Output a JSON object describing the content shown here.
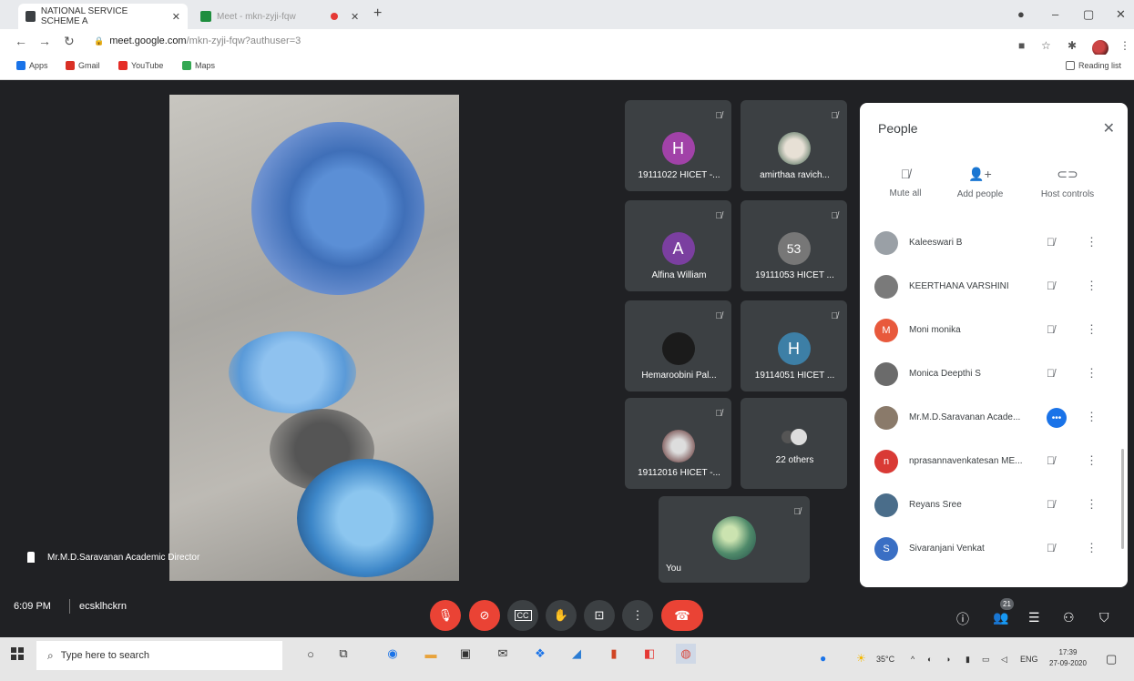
{
  "browser": {
    "tabs": [
      {
        "title": "NATIONAL SERVICE SCHEME A",
        "active": true
      },
      {
        "title": "Meet - mkn-zyji-fqw",
        "active": false
      },
      {
        "title": "",
        "active": false
      }
    ],
    "address": {
      "host": "meet.google.com",
      "path": "/mkn-zyji-fqw?authuser=3"
    },
    "bookmarks": [
      "Apps",
      "Gmail",
      "YouTube",
      "Maps"
    ],
    "reading_list": "Reading list"
  },
  "meet": {
    "main_speaker": "Mr.M.D.Saravanan Academic Director",
    "time": "6:09 PM",
    "meeting_code": "ecsklhckrn",
    "participant_count": "21",
    "tiles": [
      {
        "initial": "H",
        "name": "19111022 HICET -...",
        "color": "#a142a8"
      },
      {
        "initial": "",
        "name": "amirthaa ravich...",
        "color": "#8a9a8a"
      },
      {
        "initial": "A",
        "name": "Alfina William",
        "color": "#7b3fa0"
      },
      {
        "initial": "53",
        "name": "19111053 HICET ...",
        "color": "#777777"
      },
      {
        "initial": "",
        "name": "Hemaroobini Pal...",
        "color": "#222222"
      },
      {
        "initial": "H",
        "name": "19114051 HICET ...",
        "color": "#3d7fa6"
      },
      {
        "initial": "",
        "name": "19112016 HICET -...",
        "color": "#8c6d6d"
      },
      {
        "initial": "",
        "name": "22 others",
        "color": "#3c4043"
      },
      {
        "initial": "",
        "name": "You",
        "color": "#4f8a6a"
      }
    ]
  },
  "people": {
    "title": "People",
    "actions": [
      {
        "label": "Mute all",
        "icon": "mic-off-icon"
      },
      {
        "label": "Add people",
        "icon": "add-person-icon"
      },
      {
        "label": "Host controls",
        "icon": "toggle-icon"
      }
    ],
    "list": [
      {
        "name": "Kaleeswari B",
        "initial": "",
        "color": "#9aa0a6",
        "state": "muted"
      },
      {
        "name": "KEERTHANA VARSHINI",
        "initial": "",
        "color": "#7a7a7a",
        "state": "muted"
      },
      {
        "name": "Moni monika",
        "initial": "M",
        "color": "#e8593c",
        "state": "muted"
      },
      {
        "name": "Monica Deepthi S",
        "initial": "",
        "color": "#6b6b6b",
        "state": "muted"
      },
      {
        "name": "Mr.M.D.Saravanan Acade...",
        "initial": "",
        "color": "#8a7a6a",
        "state": "talking"
      },
      {
        "name": "nprasannavenkatesan ME...",
        "initial": "n",
        "color": "#d93a35",
        "state": "muted"
      },
      {
        "name": "Reyans Sree",
        "initial": "",
        "color": "#4a6d8a",
        "state": "muted"
      },
      {
        "name": "Sivaranjani Venkat",
        "initial": "S",
        "color": "#3a6fc4",
        "state": "muted"
      }
    ]
  },
  "taskbar": {
    "search_placeholder": "Type here to search",
    "weather": "35°C",
    "language": "ENG",
    "clock_time": "17:39",
    "clock_date": "27-09-2020"
  }
}
